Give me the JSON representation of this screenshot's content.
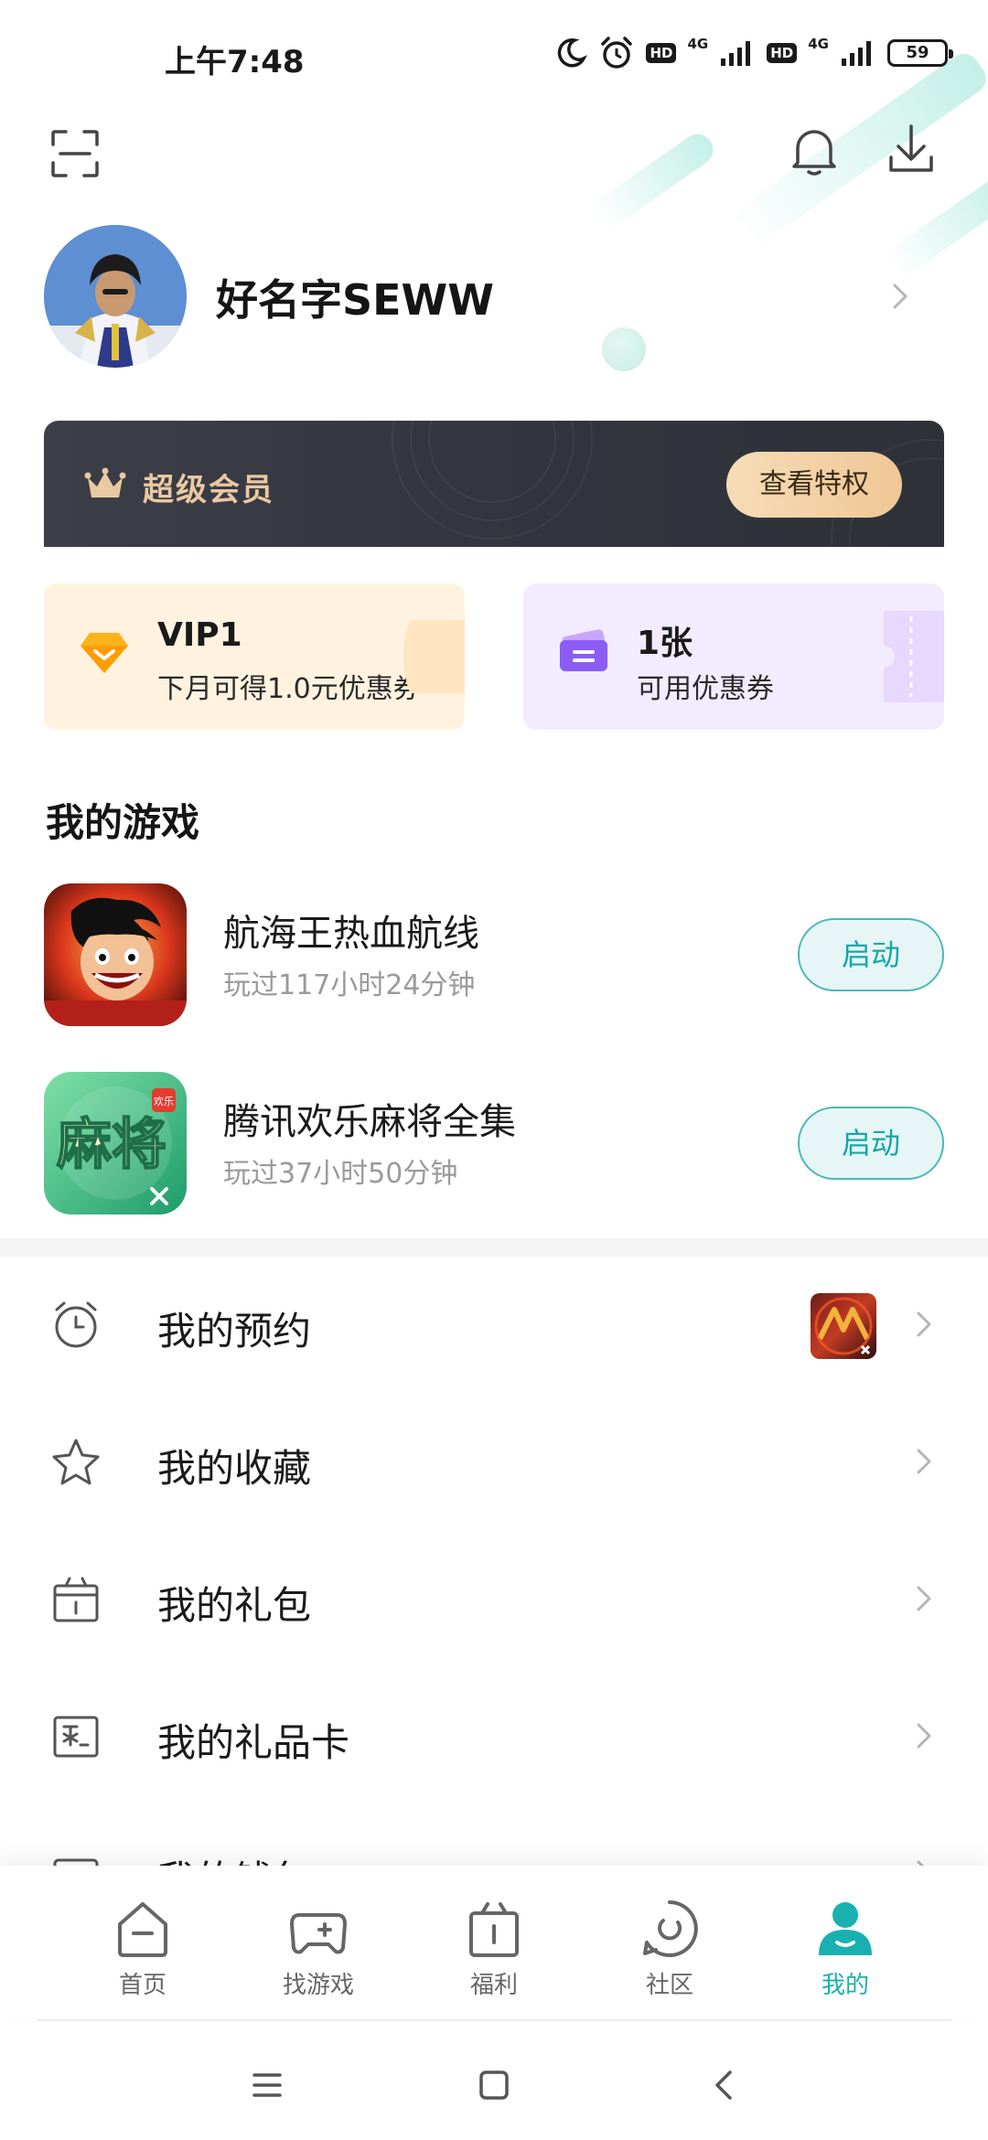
{
  "status_bar": {
    "time": "上午7:48",
    "net1": "4G",
    "net2": "4G",
    "hd": "HD",
    "battery": "59"
  },
  "profile": {
    "username": "好名字SEWW"
  },
  "vip_banner": {
    "title": "超级会员",
    "button": "查看特权"
  },
  "cards": {
    "vip": {
      "title": "VIP1",
      "subtitle": "下月可得1.0元优惠券"
    },
    "coupon": {
      "title": "1张",
      "subtitle": "可用优惠券"
    }
  },
  "my_games": {
    "title": "我的游戏",
    "items": [
      {
        "name": "航海王热血航线",
        "played": "玩过117小时24分钟",
        "action": "启动"
      },
      {
        "name": "腾讯欢乐麻将全集",
        "played": "玩过37小时50分钟",
        "action": "启动"
      }
    ]
  },
  "menu": [
    {
      "label": "我的预约",
      "icon": "alarm-clock-icon"
    },
    {
      "label": "我的收藏",
      "icon": "star-icon"
    },
    {
      "label": "我的礼包",
      "icon": "gift-box-icon"
    },
    {
      "label": "我的礼品卡",
      "icon": "gift-card-icon"
    },
    {
      "label": "我的钱包",
      "icon": "wallet-icon"
    }
  ],
  "mahjong_icon_text": {
    "main": "麻将",
    "badge": "欢乐"
  },
  "bottom_nav": [
    {
      "label": "首页",
      "icon": "home-icon",
      "active": false
    },
    {
      "label": "找游戏",
      "icon": "gamepad-icon",
      "active": false
    },
    {
      "label": "福利",
      "icon": "gift-icon",
      "active": false
    },
    {
      "label": "社区",
      "icon": "community-icon",
      "active": false
    },
    {
      "label": "我的",
      "icon": "profile-icon",
      "active": true
    }
  ],
  "colors": {
    "accent": "#1ab0b0",
    "vip_gold": "#e9c9a1",
    "vip_dark": "#32343d"
  }
}
